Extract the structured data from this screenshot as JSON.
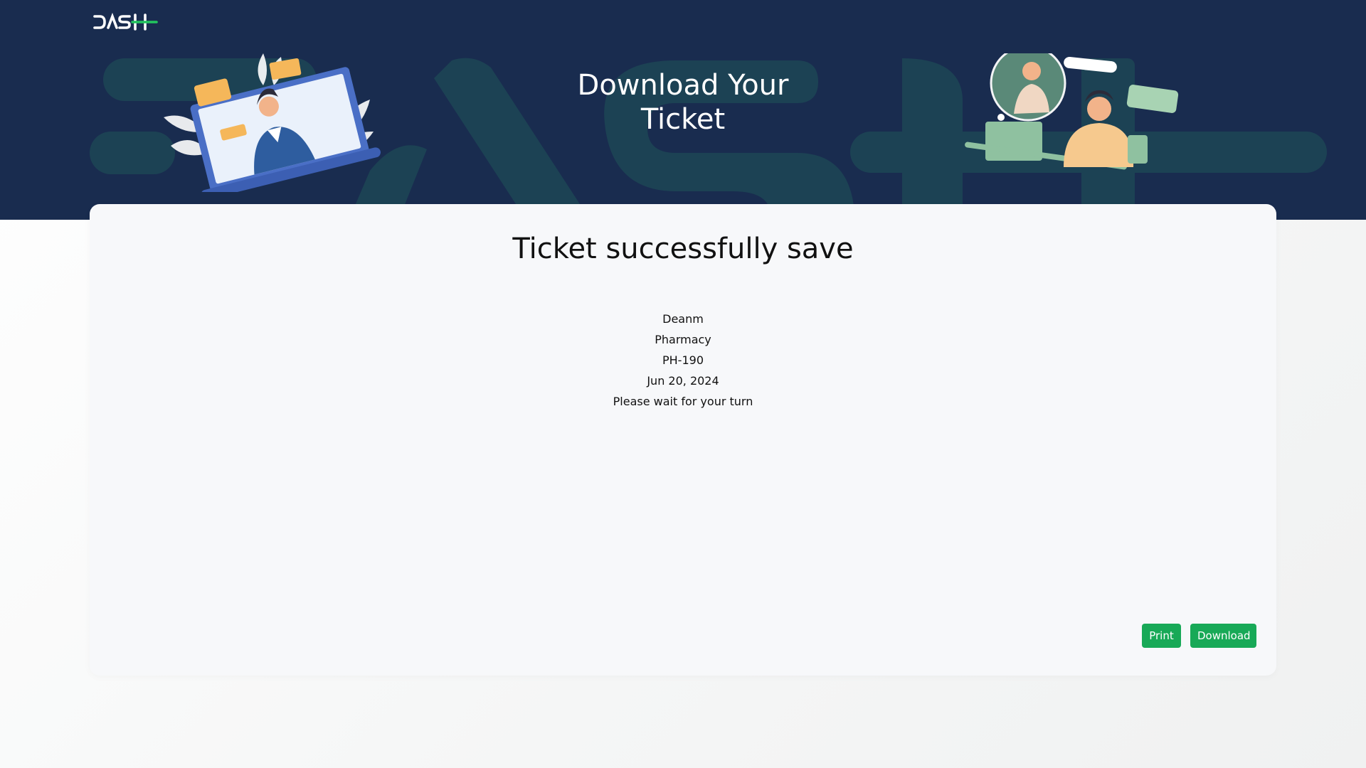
{
  "brand": {
    "logo_text": "DASH"
  },
  "hero": {
    "title_line1": "Download Your",
    "title_line2": "Ticket"
  },
  "ticket": {
    "heading": "Ticket successfully save",
    "name": "Deanm",
    "department": "Pharmacy",
    "number": "PH-190",
    "date": "Jun 20, 2024",
    "message": "Please wait for your turn"
  },
  "actions": {
    "print_label": "Print",
    "download_label": "Download"
  },
  "colors": {
    "header_bg": "#192c4f",
    "accent_green": "#18a957",
    "card_bg": "#f7f8fa"
  },
  "icons": {
    "logo": "dash-logo-icon",
    "left_illustration": "support-agent-laptop-icon",
    "right_illustration": "video-call-agent-icon"
  }
}
